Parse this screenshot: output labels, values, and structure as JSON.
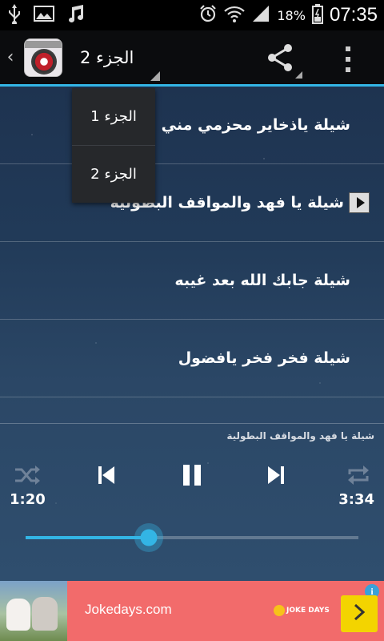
{
  "status_bar": {
    "battery_percent": "18%",
    "time": "07:35",
    "left_icons": [
      "usb-icon",
      "image-icon",
      "music-icon"
    ],
    "right_icons": [
      "alarm-icon",
      "wifi-icon",
      "signal-icon",
      "battery-icon"
    ]
  },
  "action_bar": {
    "selected_part": "الجزء 2",
    "accent_color": "#33b5e5"
  },
  "dropdown": {
    "items": [
      "الجزء 1",
      "الجزء 2"
    ]
  },
  "tracks": [
    {
      "title": "شيلة ياذخاير محزمي مني تحية"
    },
    {
      "title": "شيلة يا فهد والمواقف البطولية",
      "playing": true
    },
    {
      "title": "شيلة جابك الله بعد غيبه"
    },
    {
      "title": "شيلة فخر فخر يافضول"
    }
  ],
  "player": {
    "now_playing": "شيلة يا فهد والمواقف البطولية",
    "elapsed": "1:20",
    "duration": "3:34",
    "progress_fraction": 0.37
  },
  "ad": {
    "text": "Jokedays.com",
    "logo_text": "JOKE DAYS",
    "info_label": "i",
    "background": "#f26b6b",
    "button_color": "#f3d400"
  }
}
